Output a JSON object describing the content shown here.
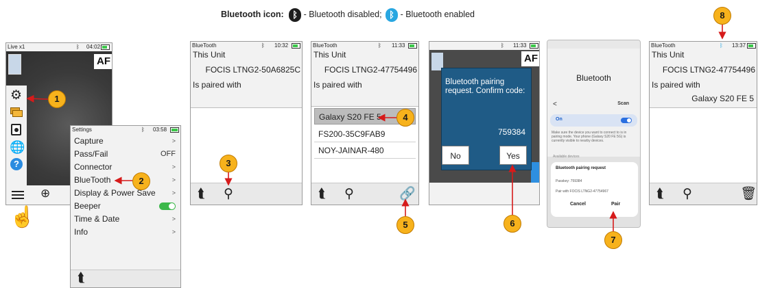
{
  "legend": {
    "title": "Bluetooth icon:",
    "disabled_text": "- Bluetooth disabled;",
    "enabled_text": "- Bluetooth enabled",
    "disabled_color": "#1e1e1e",
    "enabled_color": "#29a7e1"
  },
  "callouts": [
    "1",
    "2",
    "3",
    "4",
    "5",
    "6",
    "7",
    "8"
  ],
  "screen1": {
    "status_title": "Live x1",
    "clock": "04:02",
    "af_label": "AF",
    "icons": [
      "gear-icon",
      "folders-icon",
      "record-icon",
      "globe-icon",
      "help-icon",
      "menu-icon",
      "zoom-in-icon"
    ]
  },
  "settings": {
    "status_title": "Settings",
    "clock": "03:58",
    "items": [
      {
        "label": "Capture",
        "value": ">"
      },
      {
        "label": "Pass/Fail",
        "value": "OFF"
      },
      {
        "label": "Connector",
        "value": ">"
      },
      {
        "label": "BlueTooth",
        "value": ">"
      },
      {
        "label": "Display & Power Save",
        "value": ">"
      },
      {
        "label": "Beeper",
        "value": ""
      },
      {
        "label": "Time & Date",
        "value": ">"
      },
      {
        "label": "Info",
        "value": ">"
      }
    ],
    "beeper_on": true
  },
  "screen3": {
    "status_title": "BlueTooth",
    "clock": "10:32",
    "this_unit": "This Unit",
    "unit_name": "FOCIS LTNG2-50A6825C",
    "paired_with": "Is paired with"
  },
  "screen4": {
    "status_title": "BlueTooth",
    "clock": "11:33",
    "this_unit": "This Unit",
    "unit_name": "FOCIS LTNG2-47754496",
    "paired_with": "Is paired with",
    "devices": [
      "Galaxy S20 FE 5",
      "FS200-35C9FAB9",
      "NOY-JAINAR-480"
    ]
  },
  "screen5": {
    "clock": "11:33",
    "af_label": "AF",
    "dialog_text": "Bluetooth pairing request. Confirm code:",
    "code": "759384",
    "no_label": "No",
    "yes_label": "Yes"
  },
  "phone": {
    "title": "Bluetooth",
    "back": "<",
    "scan": "Scan",
    "on_label": "On",
    "hint": "Make sure the device you want to connect to is in pairing mode. Your phone (Galaxy S20 FE 5G) is currently visible to nearby devices.",
    "available": "Available devices",
    "dialog_title": "Bluetooth pairing request",
    "passkey": "Passkey: 759384",
    "pair_with": "Pair with FOCIS LTNG2-47754967",
    "cancel": "Cancel",
    "pair": "Pair"
  },
  "screen7": {
    "status_title": "BlueTooth",
    "clock": "13:37",
    "this_unit": "This Unit",
    "unit_name": "FOCIS LTNG2-47754496",
    "paired_with": "Is paired with",
    "paired_device": "Galaxy S20 FE 5"
  }
}
